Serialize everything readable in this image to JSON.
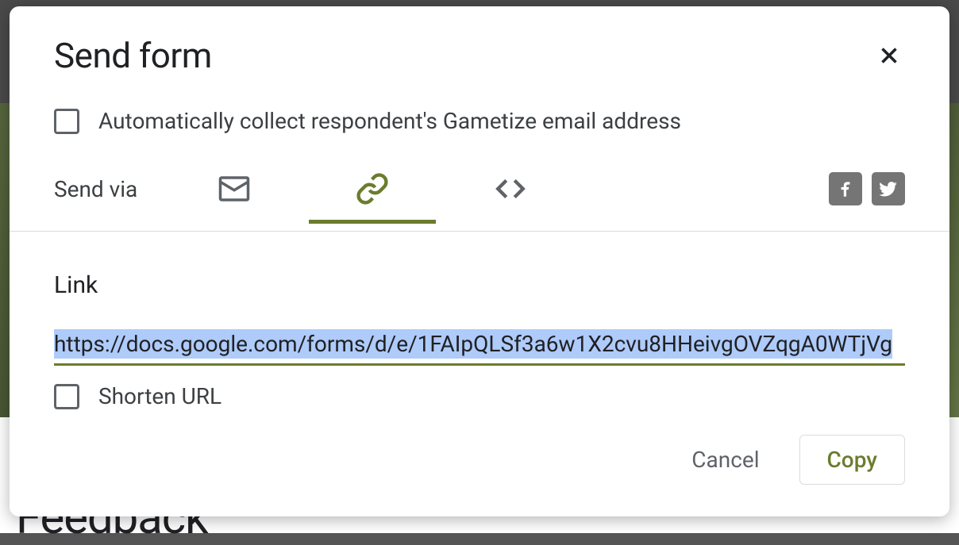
{
  "dialog": {
    "title": "Send form",
    "collect_email_label": "Automatically collect respondent's Gametize email address",
    "send_via_label": "Send via",
    "link_section_label": "Link",
    "link_url": "https://docs.google.com/forms/d/e/1FAIpQLSf3a6w1X2cvu8HHeivgOVZqgA0WTjVg",
    "shorten_url_label": "Shorten URL",
    "cancel_label": "Cancel",
    "copy_label": "Copy"
  },
  "colors": {
    "accent": "#6b7c2e"
  },
  "background": {
    "partial_text": "Feedback"
  }
}
